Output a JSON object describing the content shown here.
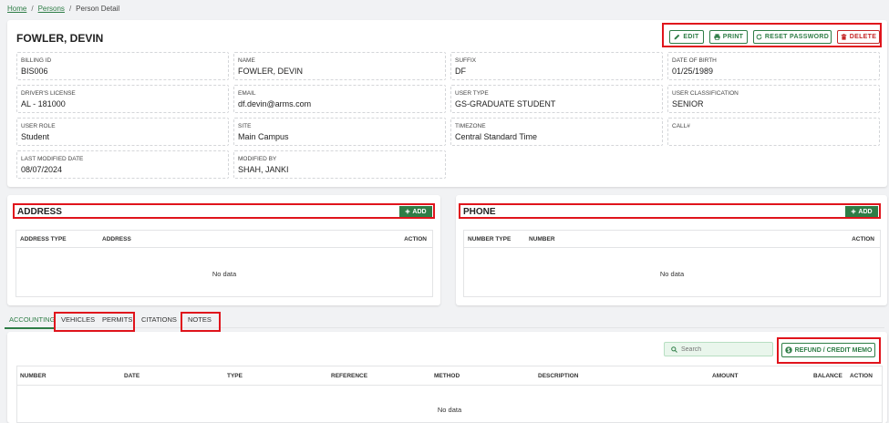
{
  "breadcrumb": {
    "home": "Home",
    "persons": "Persons",
    "current": "Person Detail",
    "sep": "/"
  },
  "person": {
    "name": "FOWLER, DEVIN",
    "actions": {
      "edit": "EDIT",
      "print": "PRINT",
      "reset": "RESET PASSWORD",
      "delete": "DELETE"
    },
    "fields": [
      {
        "label": "BILLING ID",
        "value": "BIS006"
      },
      {
        "label": "NAME",
        "value": "FOWLER, DEVIN"
      },
      {
        "label": "SUFFIX",
        "value": "DF"
      },
      {
        "label": "DATE OF BIRTH",
        "value": "01/25/1989"
      },
      {
        "label": "DRIVER'S LICENSE",
        "value": "AL - 181000"
      },
      {
        "label": "EMAIL",
        "value": "df.devin@arms.com"
      },
      {
        "label": "USER TYPE",
        "value": "GS-GRADUATE STUDENT"
      },
      {
        "label": "USER CLASSIFICATION",
        "value": "SENIOR"
      },
      {
        "label": "USER ROLE",
        "value": "Student"
      },
      {
        "label": "SITE",
        "value": "Main Campus"
      },
      {
        "label": "TIMEZONE",
        "value": "Central Standard Time"
      },
      {
        "label": "CALL#",
        "value": ""
      },
      {
        "label": "LAST MODIFIED DATE",
        "value": "08/07/2024"
      },
      {
        "label": "MODIFIED BY",
        "value": "SHAH, JANKI"
      }
    ]
  },
  "address": {
    "title": "ADDRESS",
    "add_label": "ADD",
    "columns": [
      "ADDRESS TYPE",
      "ADDRESS",
      "ACTION"
    ],
    "empty": "No data"
  },
  "phone": {
    "title": "PHONE",
    "add_label": "ADD",
    "columns": [
      "NUMBER TYPE",
      "NUMBER",
      "ACTION"
    ],
    "empty": "No data"
  },
  "tabs": [
    "ACCOUNTING",
    "VEHICLES",
    "PERMITS",
    "CITATIONS",
    "NOTES"
  ],
  "accounting": {
    "search_placeholder": "Search",
    "refund_label": "REFUND / CREDIT MEMO",
    "columns": [
      "NUMBER",
      "DATE",
      "TYPE",
      "REFERENCE",
      "METHOD",
      "DESCRIPTION",
      "AMOUNT",
      "BALANCE",
      "ACTION"
    ],
    "empty": "No data"
  },
  "colors": {
    "accent": "#2e7d46",
    "highlight": "#e0141c",
    "danger": "#c62828"
  },
  "icons": {
    "edit": "pencil-icon",
    "print": "printer-icon",
    "reset": "refresh-icon",
    "delete": "trash-icon",
    "add": "plus-icon",
    "search": "search-icon",
    "refund": "dollar-circle-icon"
  }
}
